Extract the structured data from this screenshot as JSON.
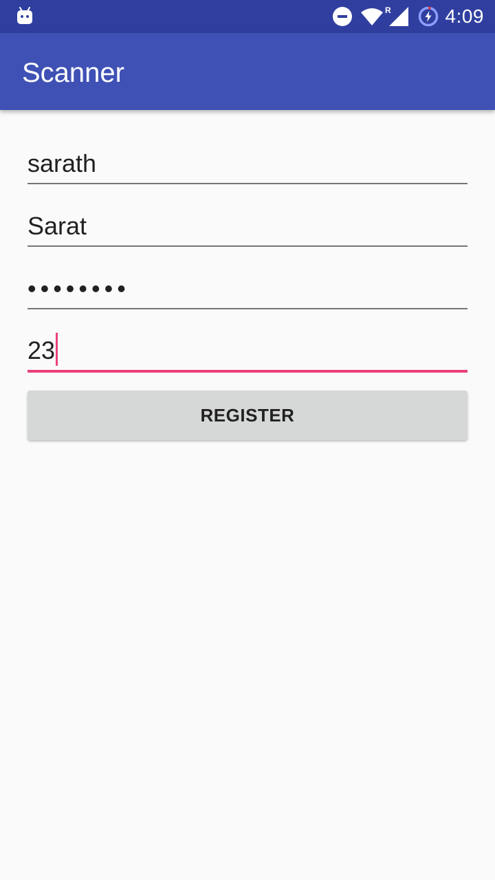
{
  "status_bar": {
    "time": "4:09",
    "icons": [
      "android-icon",
      "dnd-icon",
      "wifi-icon",
      "roaming-signal-icon",
      "battery-charging-icon"
    ],
    "roaming_label": "R"
  },
  "app_bar": {
    "title": "Scanner",
    "color": "#3f51b5"
  },
  "form": {
    "username_value": "sarath",
    "name_value": "Sarat",
    "password_mask": "••••••••",
    "age_value": "23",
    "register_label": "REGISTER",
    "accent_color": "#ec407a"
  }
}
